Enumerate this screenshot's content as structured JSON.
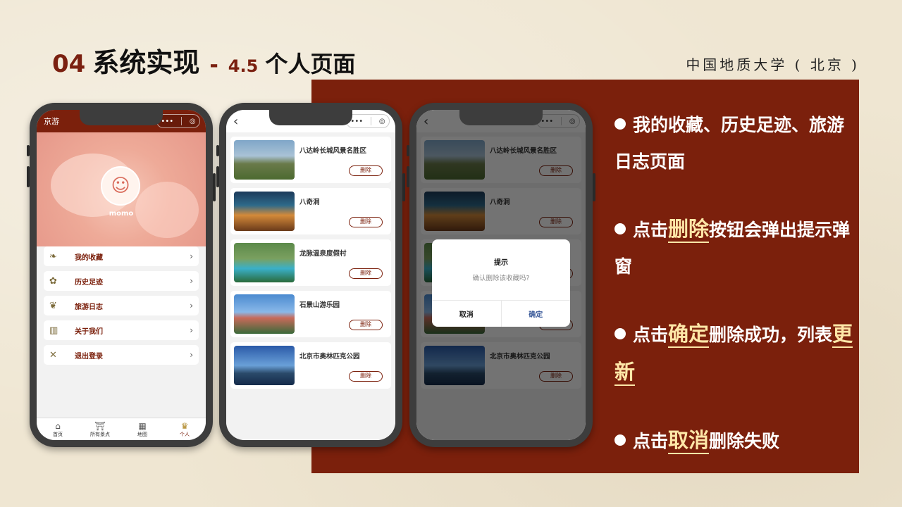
{
  "header": {
    "section_num": "04",
    "section_title": "系统实现",
    "dash": "-",
    "sub_num": "4.5",
    "sub_title": "个人页面",
    "org": "中国地质大学 ( 北京 )"
  },
  "phone1": {
    "app_title": "京游",
    "capsule_more": "•••",
    "capsule_close": "◎",
    "username": "momo",
    "menu": [
      {
        "icon": "favorites-icon",
        "label": "我的收藏"
      },
      {
        "icon": "history-icon",
        "label": "历史足迹"
      },
      {
        "icon": "journal-icon",
        "label": "旅游日志"
      },
      {
        "icon": "about-icon",
        "label": "关于我们"
      },
      {
        "icon": "logout-icon",
        "label": "退出登录"
      }
    ],
    "tabs": [
      {
        "icon": "home-icon",
        "label": "首页"
      },
      {
        "icon": "scenic-icon",
        "label": "所有景点"
      },
      {
        "icon": "map-icon",
        "label": "地图"
      },
      {
        "icon": "profile-icon",
        "label": "个人"
      }
    ]
  },
  "list": {
    "back": "‹",
    "delete_label": "删除",
    "items": [
      {
        "name": "八达岭长城风景名胜区"
      },
      {
        "name": "八奇洞"
      },
      {
        "name": "龙脉温泉度假村"
      },
      {
        "name": "石景山游乐园"
      },
      {
        "name": "北京市奥林匹克公园"
      }
    ]
  },
  "dialog": {
    "title": "提示",
    "message": "确认删除该收藏吗?",
    "cancel": "取消",
    "confirm": "确定"
  },
  "bullets": [
    {
      "pre": "我的收藏、历史足迹、旅游日志页面",
      "hl": "",
      "post": ""
    },
    {
      "pre": "点击",
      "hl": "删除",
      "post": "按钮会弹出提示弹窗"
    },
    {
      "pre": "点击",
      "hl": "确定",
      "post": "删除成功，列表",
      "hl2": "更新"
    },
    {
      "pre": "点击",
      "hl": "取消",
      "post": "删除失败"
    }
  ],
  "colors": {
    "accent": "#7b200c",
    "highlight": "#ffe7a8",
    "background": "#efe6d2"
  }
}
